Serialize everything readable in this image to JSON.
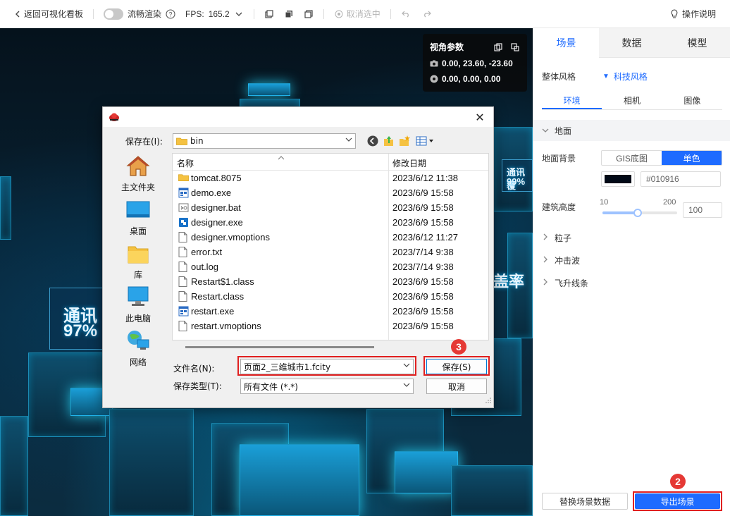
{
  "toolbar": {
    "back_label": "返回可视化看板",
    "smooth_render_label": "流畅渲染",
    "fps_label": "FPS:",
    "fps_value": "165.2",
    "deselect_label": "取消选中",
    "help_label": "操作说明"
  },
  "view_params": {
    "title": "视角参数",
    "camera_position": "0.00, 23.60, -23.60",
    "target_position": "0.00, 0.00, 0.00"
  },
  "scene_labels": {
    "comm_small_title": "通讯覆",
    "comm_small_value": "99%",
    "comm_big_title": "通讯",
    "comm_big_value": "97%",
    "coverage": "盖率"
  },
  "right_panel": {
    "tabs": [
      "场景",
      "数据",
      "模型"
    ],
    "active_tab": 0,
    "overall_style_label": "整体风格",
    "overall_style_value": "科技风格",
    "subtabs": [
      "环境",
      "相机",
      "图像"
    ],
    "active_subtab": 0,
    "ground_section": "地面",
    "ground_bg_label": "地面背景",
    "ground_bg_options": [
      "GIS底图",
      "单色"
    ],
    "ground_bg_selected": 1,
    "ground_color_hex": "#010916",
    "building_height_label": "建筑高度",
    "slider_min": "10",
    "slider_max": "200",
    "building_height_value": "100",
    "building_height_fraction": 0.47,
    "sections": [
      "粒子",
      "冲击波",
      "飞升线条"
    ],
    "replace_button": "替换场景数据",
    "export_button": "导出场景",
    "colors": {
      "accent": "#1e6bff",
      "ground_swatch": "#010916"
    }
  },
  "dialog": {
    "save_in_label": "保存在(I):",
    "save_in_value": "bin",
    "places": [
      "主文件夹",
      "桌面",
      "库",
      "此电脑",
      "网络"
    ],
    "column_name": "名称",
    "column_date": "修改日期",
    "files": [
      {
        "name": "tomcat.8075",
        "date": "2023/6/12 11:38",
        "type": "folder"
      },
      {
        "name": "demo.exe",
        "date": "2023/6/9 15:58",
        "type": "exe"
      },
      {
        "name": "designer.bat",
        "date": "2023/6/9 15:58",
        "type": "bat"
      },
      {
        "name": "designer.exe",
        "date": "2023/6/9 15:58",
        "type": "app"
      },
      {
        "name": "designer.vmoptions",
        "date": "2023/6/12 11:27",
        "type": "file"
      },
      {
        "name": "error.txt",
        "date": "2023/7/14 9:38",
        "type": "file"
      },
      {
        "name": "out.log",
        "date": "2023/7/14 9:38",
        "type": "file"
      },
      {
        "name": "Restart$1.class",
        "date": "2023/6/9 15:58",
        "type": "file"
      },
      {
        "name": "Restart.class",
        "date": "2023/6/9 15:58",
        "type": "file"
      },
      {
        "name": "restart.exe",
        "date": "2023/6/9 15:58",
        "type": "exe"
      },
      {
        "name": "restart.vmoptions",
        "date": "2023/6/9 15:58",
        "type": "file"
      }
    ],
    "filename_label": "文件名(N):",
    "filename_value": "页面2_三维城市1.fcity",
    "filetype_label": "保存类型(T):",
    "filetype_value": "所有文件 (*.*)",
    "save_button": "保存(S)",
    "cancel_button": "取消"
  },
  "annotations": {
    "badge_save": "3",
    "badge_export": "2"
  }
}
